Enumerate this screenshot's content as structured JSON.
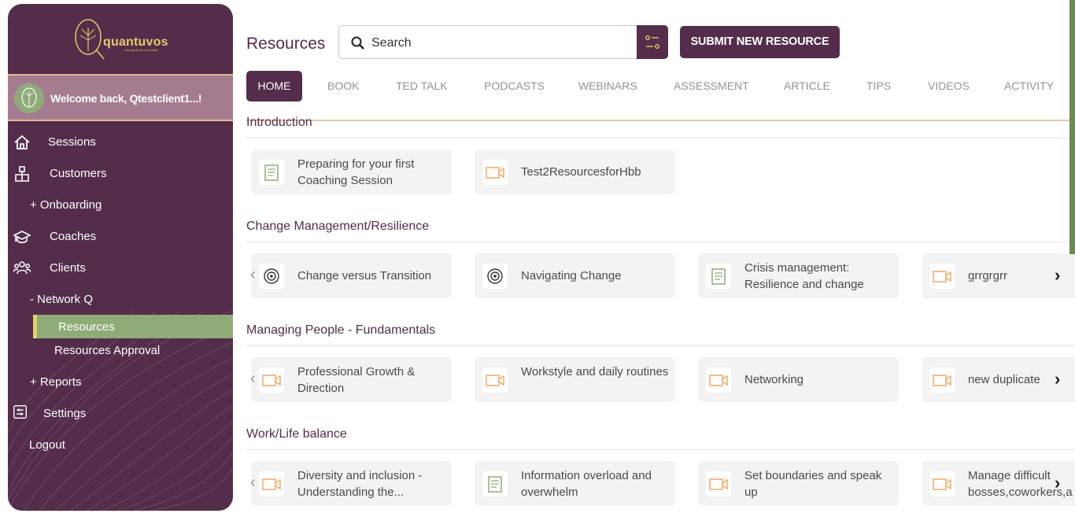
{
  "brand": {
    "name": "quantuvos",
    "tagline": "Choose to be Your Best"
  },
  "welcome": "Welcome back, Qtestclient1...!",
  "nav": [
    {
      "label": "Sessions",
      "icon": "home-icon"
    },
    {
      "label": "Customers",
      "icon": "org-chart-icon"
    },
    {
      "label": "+ Onboarding"
    },
    {
      "label": "Coaches",
      "icon": "graduation-cap-icon"
    },
    {
      "label": "Clients",
      "icon": "people-group-icon"
    },
    {
      "label": "- Network Q"
    },
    {
      "label": "Resources"
    },
    {
      "label": "Resources Approval"
    },
    {
      "label": "+ Reports"
    },
    {
      "label": "Settings",
      "icon": "settings-sliders-icon"
    },
    {
      "label": "Logout"
    }
  ],
  "header": {
    "title": "Resources",
    "search_placeholder": "Search",
    "submit_label": "SUBMIT NEW RESOURCE"
  },
  "tabs": [
    "HOME",
    "BOOK",
    "TED TALK",
    "PODCASTS",
    "WEBINARS",
    "ASSESSMENT",
    "ARTICLE",
    "TIPS",
    "VIDEOS",
    "ACTIVITY"
  ],
  "sections": [
    {
      "title": "Introduction",
      "cards": [
        {
          "text": "Preparing for your first Coaching Session",
          "icon": "book-icon"
        },
        {
          "text": "Test2ResourcesforHbb",
          "icon": "video-icon"
        }
      ]
    },
    {
      "title": "Change Management/Resilience",
      "cards": [
        {
          "text": "Change versus Transition",
          "icon": "podcast-icon"
        },
        {
          "text": "Navigating Change",
          "icon": "podcast-icon"
        },
        {
          "text": "Crisis management: Resilience and change",
          "icon": "book-icon"
        },
        {
          "text": "grrgrgrr",
          "icon": "video-icon"
        }
      ]
    },
    {
      "title": "Managing People - Fundamentals",
      "cards": [
        {
          "text": "Professional Growth & Direction",
          "icon": "video-icon"
        },
        {
          "text": "Workstyle and daily routines",
          "icon": "video-icon"
        },
        {
          "text": "Networking",
          "icon": "video-icon"
        },
        {
          "text": "new duplicate",
          "icon": "video-icon"
        }
      ]
    },
    {
      "title": "Work/Life balance",
      "cards": [
        {
          "text": "Diversity and inclusion - Understanding the...",
          "icon": "video-icon"
        },
        {
          "text": "Information overload and overwhelm",
          "icon": "book-icon"
        },
        {
          "text": "Set boundaries and speak up",
          "icon": "video-icon"
        },
        {
          "text": "Manage difficult bosses,coworkers,a",
          "icon": "video-icon"
        }
      ]
    }
  ],
  "colors": {
    "primary": "#532d4a",
    "accent": "#8fab78",
    "highlight": "#e0d46c",
    "video": "#f0a867"
  }
}
